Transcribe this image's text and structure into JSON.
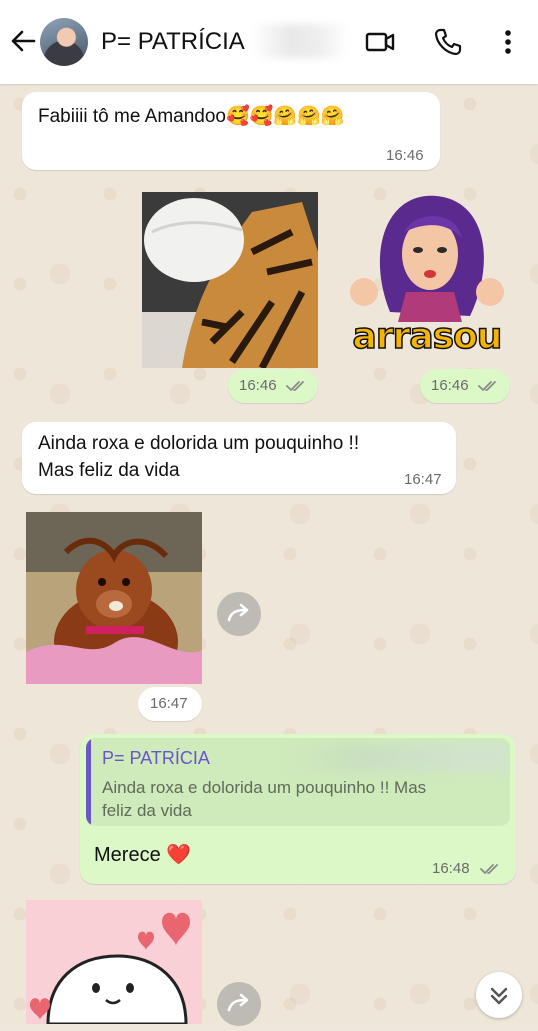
{
  "header": {
    "contact_name": "P= PATRÍCIA",
    "icons": [
      "back-arrow-icon",
      "video-call-icon",
      "phone-icon",
      "more-vert-icon"
    ]
  },
  "messages": [
    {
      "text": "Fabiiii tô me Amandoo🥰🥰🤗🤗🤗",
      "time": "16:46",
      "direction": "incoming"
    },
    {
      "type": "image",
      "time": "16:46",
      "direction": "outgoing"
    },
    {
      "type": "sticker",
      "caption": "arrasou",
      "time": "16:46",
      "direction": "outgoing"
    },
    {
      "text_line1": "Ainda roxa e dolorida um pouquinho !!",
      "text_line2": "Mas feliz da vida",
      "time": "16:47",
      "direction": "incoming"
    },
    {
      "type": "sticker",
      "time": "16:47",
      "direction": "incoming"
    },
    {
      "quote_author": "P= PATRÍCIA",
      "quote_line1": "Ainda roxa e dolorida um pouquinho !! Mas",
      "quote_line2": "feliz da vida",
      "text": "Merece ❤️",
      "time": "16:48",
      "direction": "outgoing"
    }
  ],
  "colors": {
    "outgoing_bubble": "#dcf8c6",
    "incoming_bubble": "#ffffff",
    "quote_accent": "#6b55c9",
    "read_ticks": "#8a8a8a"
  }
}
